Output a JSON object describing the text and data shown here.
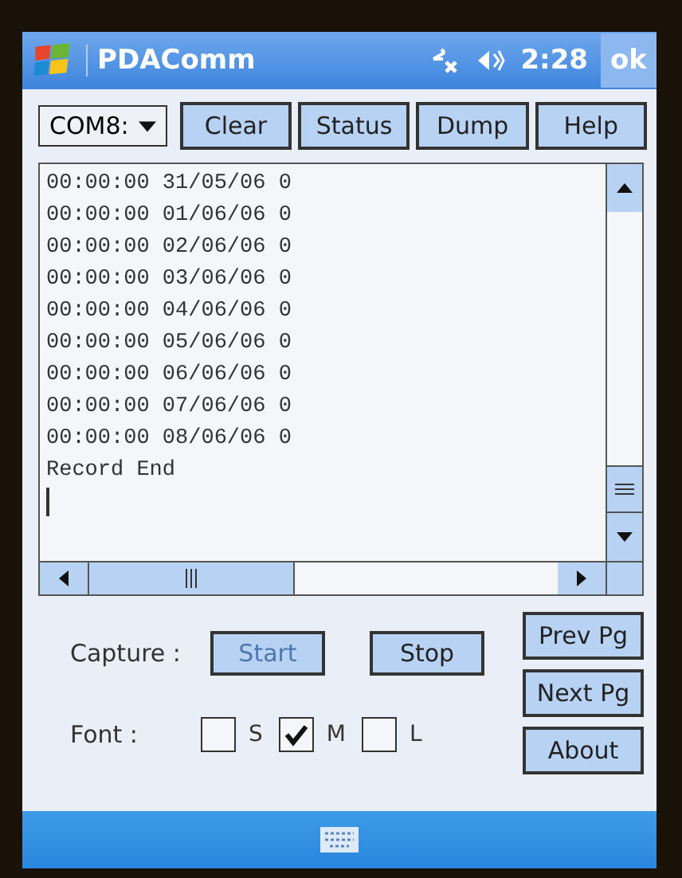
{
  "title_bar": {
    "title": "PDAComm",
    "time": "2:28",
    "ok": "ok"
  },
  "toolbar": {
    "port": "COM8:",
    "buttons": [
      "Clear",
      "Status",
      "Dump",
      "Help"
    ]
  },
  "log": {
    "lines": [
      "00:00:00 31/05/06 0",
      "00:00:00 01/06/06 0",
      "00:00:00 02/06/06 0",
      "00:00:00 03/06/06 0",
      "00:00:00 04/06/06 0",
      "00:00:00 05/06/06 0",
      "00:00:00 06/06/06 0",
      "00:00:00 07/06/06 0",
      "00:00:00 08/06/06 0",
      "Record End"
    ]
  },
  "capture": {
    "label": "Capture :",
    "buttons": [
      {
        "label": "Start",
        "disabled": true
      },
      {
        "label": "Stop",
        "disabled": false
      }
    ]
  },
  "font": {
    "label": "Font :",
    "options": [
      {
        "label": "S",
        "checked": false
      },
      {
        "label": "M",
        "checked": true
      },
      {
        "label": "L",
        "checked": false
      }
    ]
  },
  "side_buttons": [
    "Prev Pg",
    "Next Pg",
    "About"
  ]
}
